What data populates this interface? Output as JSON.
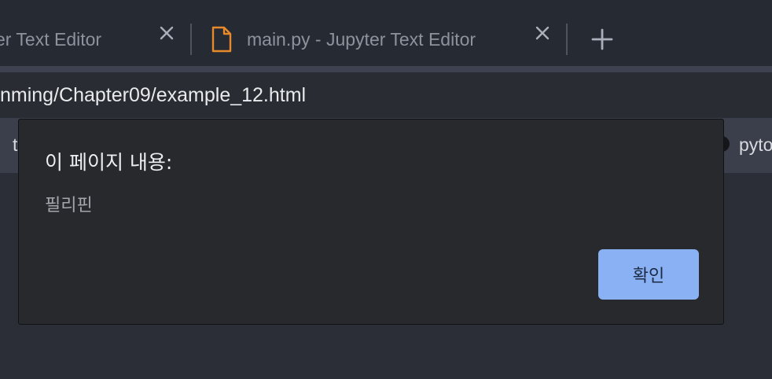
{
  "tabs": [
    {
      "label": "er Text Editor",
      "icon": "close-icon"
    },
    {
      "label": "main.py - Jupyter Text Editor",
      "icon": "file-icon",
      "icon_color": "#e8892b"
    }
  ],
  "new_tab_icon": "plus-icon",
  "address_bar": {
    "url": "nming/Chapter09/example_12.html"
  },
  "bookmarks": [
    {
      "label": "t"
    },
    {
      "label": "pyto"
    }
  ],
  "dialog": {
    "title": "이 페이지 내용:",
    "message": "필리핀",
    "ok_label": "확인",
    "ok_color": "#8ab1f4"
  }
}
